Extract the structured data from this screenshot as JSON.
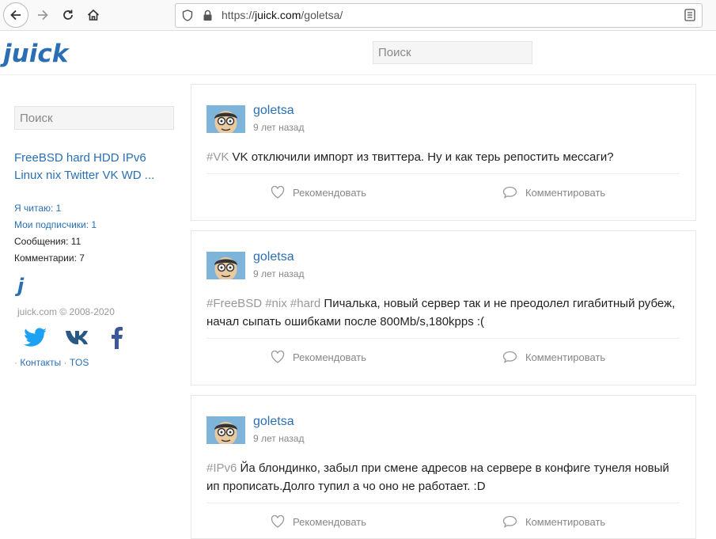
{
  "browser": {
    "url_prefix": "https://",
    "url_domain": "juick.com",
    "url_path": "/goletsa/"
  },
  "site": {
    "logo": "juick",
    "search_placeholder": "Поиск"
  },
  "sidebar": {
    "search_placeholder": "Поиск",
    "tags_line1": "FreeBSD hard HDD IPv6",
    "tags_line2": "Linux nix Twitter VK WD ...",
    "reading": "Я читаю: 1",
    "subscribers": "Мои подписчики: 1",
    "messages": "Сообщения: 11",
    "comments": "Комментарии: 7",
    "copyright": "juick.com © 2008-2020",
    "footer_sep1": "·",
    "contacts": "Контакты",
    "footer_sep2": "·",
    "tos": "TOS"
  },
  "posts": [
    {
      "user": "goletsa",
      "time": "9 лет назад",
      "tags": "#VK",
      "text": "VK отключили импорт из твиттера. Ну и как терь репостить мессаги?",
      "recommend": "Рекомендовать",
      "comment": "Комментировать"
    },
    {
      "user": "goletsa",
      "time": "9 лет назад",
      "tags": "#FreeBSD #nix #hard",
      "text": "Пичалька, новый сервер так и не преодолел гигабитный рубеж, начал сыпать ошибками после 800Mb/s,180kpps :(",
      "recommend": "Рекомендовать",
      "comment": "Комментировать"
    },
    {
      "user": "goletsa",
      "time": "9 лет назад",
      "tags": "#IPv6",
      "text": "Йа блондинко, забыл при смене адресов на сервере в конфиге тунеля новый ип прописать.Долго тупил а чо оно не работает. :D",
      "recommend": "Рекомендовать",
      "comment": "Комментировать"
    }
  ],
  "colors": {
    "accent": "#2a6fb4",
    "tag": "#999999",
    "twitter": "#1da1f2"
  }
}
